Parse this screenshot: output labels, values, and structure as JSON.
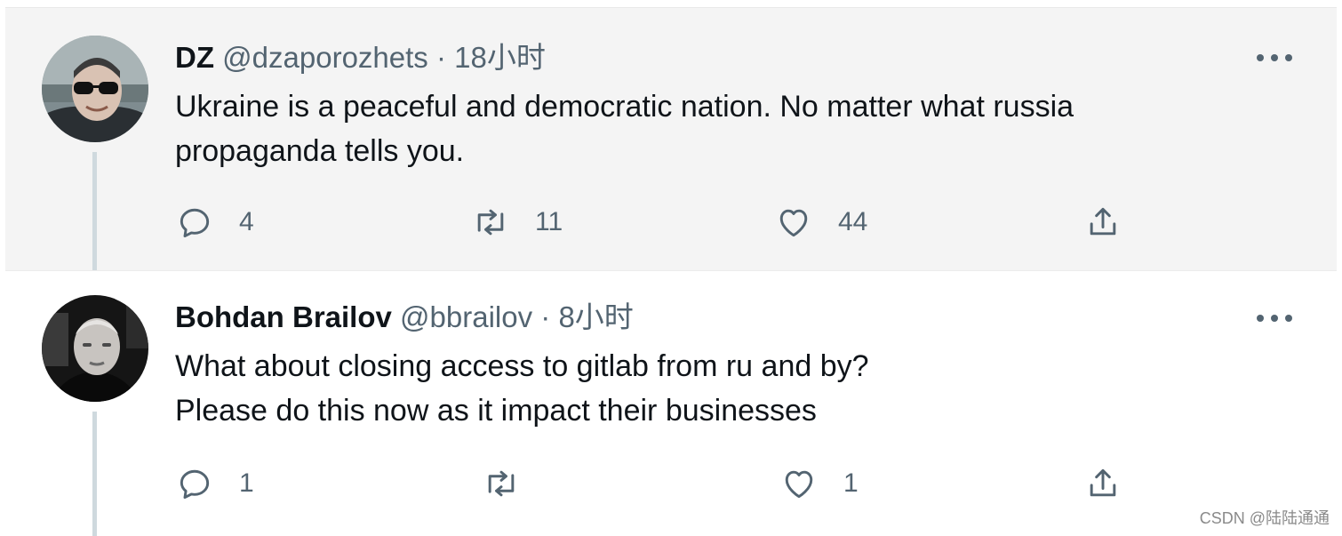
{
  "tweets": [
    {
      "name": "DZ",
      "handle": "@dzaporozhets",
      "dot": "·",
      "time": "18小时",
      "text_lines": [
        "Ukraine is a peaceful and democratic nation. No matter what russia",
        "propaganda tells you."
      ],
      "replies": "4",
      "retweets": "11",
      "likes": "44"
    },
    {
      "name": "Bohdan Brailov",
      "handle": "@bbrailov",
      "dot": "·",
      "time": "8小时",
      "text_lines": [
        "What about closing access to gitlab from ru and by?",
        "Please do this now as it impact their businesses"
      ],
      "replies": "1",
      "retweets": "",
      "likes": "1"
    }
  ],
  "watermark": "CSDN @陆陆通通",
  "colors": {
    "text": "#0f1419",
    "secondary": "#536471",
    "thread": "#cfd9de",
    "highlight_bg": "#f4f4f4"
  },
  "icons": [
    "reply-icon",
    "retweet-icon",
    "like-icon",
    "share-icon",
    "more-icon"
  ]
}
